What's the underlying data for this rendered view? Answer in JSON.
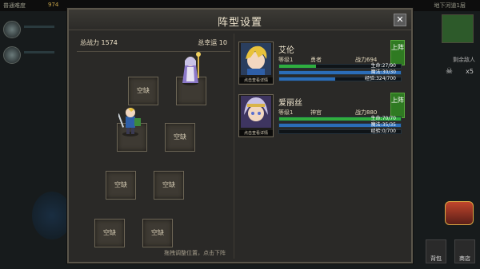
{
  "topbar": {
    "mode": "普通难度",
    "gold": "974",
    "location": "地下河道1层"
  },
  "right_panel": {
    "remaining_label": "剩余敌人",
    "count": "x5",
    "back_label": "背包",
    "shop_label": "商店",
    "shop_icon": "$"
  },
  "dialog": {
    "title": "阵型设置",
    "close_icon": "✕",
    "total_power": "总战力 1574",
    "total_luck": "总幸运 10",
    "empty_slot": "空缺",
    "hint": "拖拽调整位置，点击下阵"
  },
  "heroes": [
    {
      "name": "艾伦",
      "level": "等级1",
      "class": "勇者",
      "power": "战力694",
      "portrait_tip": "点击查看详情",
      "deploy": "上阵",
      "hp": "生命:27/90",
      "mp": "魔法:30/30",
      "xp": "经验:324/700",
      "hp_ratio": 0.3,
      "mp_ratio": 1.0,
      "xp_ratio": 0.463
    },
    {
      "name": "爱丽丝",
      "level": "等级1",
      "class": "神官",
      "power": "战力880",
      "portrait_tip": "点击查看详情",
      "deploy": "上阵",
      "hp": "生命:70/70",
      "mp": "魔法:35/35",
      "xp": "经验:0/700",
      "hp_ratio": 1.0,
      "mp_ratio": 1.0,
      "xp_ratio": 0.0
    }
  ],
  "colors": {
    "hp": "#2fae3e",
    "mp": "#2b6db8",
    "deploy": "#2f7a22",
    "panel": "#2a2927"
  }
}
